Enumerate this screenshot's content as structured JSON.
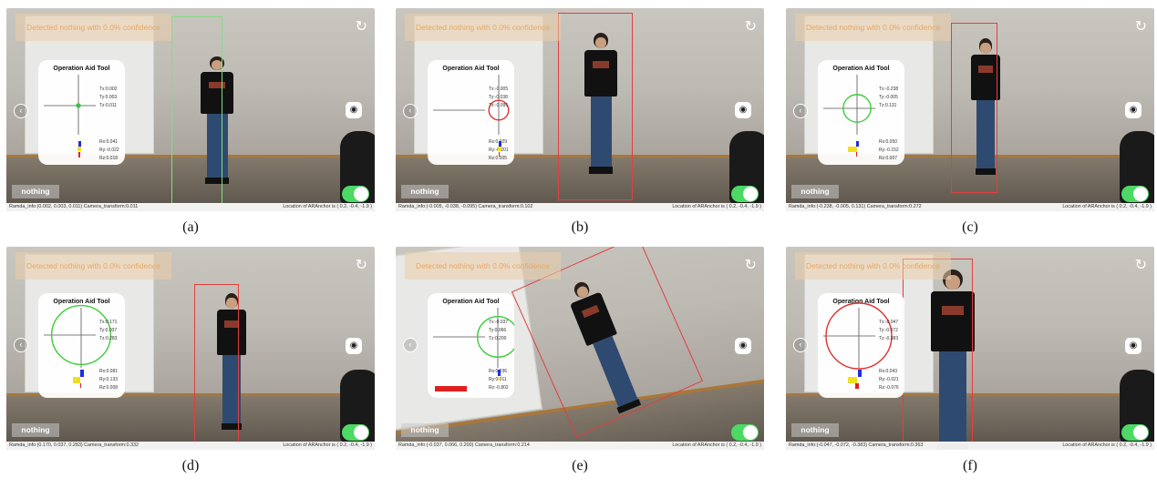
{
  "figure": {
    "panels": [
      {
        "caption": "(a)",
        "detection_text": "Detected nothing with 0.0% confidence",
        "aid_title": "Operation Aid Tool",
        "t_values": [
          "Tx:0.002",
          "Ty:0.003",
          "Tz:0.011"
        ],
        "r_values": [
          "Rx:0.041",
          "Ry:-0.022",
          "Rz:0.018"
        ],
        "nothing_label": "nothing",
        "status_left": "Ramda_info:(0.002, 0.003, 0.011)  Camera_transform:0.011",
        "status_right": "Location of ARAnchor is ( 0.2, -0.4, -1.9 )",
        "bbox_color": "#7fe07f",
        "circle_color": "#3cc43c",
        "circle_radius_fraction": 0.04
      },
      {
        "caption": "(b)",
        "detection_text": "Detected nothing with 0.0% confidence",
        "aid_title": "Operation Aid Tool",
        "t_values": [
          "Tx:-0.005",
          "Ty:-0.038",
          "Tz:-0.095"
        ],
        "r_values": [
          "Rx:0.029",
          "Ry:-0.201",
          "Rz:0.005"
        ],
        "nothing_label": "nothing",
        "status_left": "Ramda_info:(-0.005, -0.038, -0.095)  Camera_transform:0.102",
        "status_right": "Location of ARAnchor is ( 0.2, -0.4, -1.9 )",
        "bbox_color": "#e04040",
        "circle_color": "#e03030",
        "circle_radius_fraction": 0.3
      },
      {
        "caption": "(c)",
        "detection_text": "Detected nothing with 0.0% confidence",
        "aid_title": "Operation Aid Tool",
        "t_values": [
          "Tx:-0.238",
          "Ty:-0.005",
          "Tz:0.131"
        ],
        "r_values": [
          "Rx:0.050",
          "Ry:-0.152",
          "Rz:0.007"
        ],
        "nothing_label": "nothing",
        "status_left": "Ramda_info:(-0.238, -0.005, 0.131)  Camera_transform:0.272",
        "status_right": "Location of ARAnchor is ( 0.2, -0.4, -1.9 )",
        "bbox_color": "#e04040",
        "circle_color": "#3ccc3c",
        "circle_radius_fraction": 0.42
      },
      {
        "caption": "(d)",
        "detection_text": "Detected nothing with 0.0% confidence",
        "aid_title": "Operation Aid Tool",
        "t_values": [
          "Tx:0.171",
          "Ty:0.037",
          "Tz:0.283"
        ],
        "r_values": [
          "Rx:0.081",
          "Ry:0.133",
          "Rz:0.008"
        ],
        "nothing_label": "nothing",
        "status_left": "Ramda_info:(0.170, 0.037, 0.283)  Camera_transform:0.332",
        "status_right": "Location of ARAnchor is ( 0.2, -0.4, -1.9 )",
        "bbox_color": "#e04040",
        "circle_color": "#3ccc3c",
        "circle_radius_fraction": 0.9
      },
      {
        "caption": "(e)",
        "detection_text": "Detected nothing with 0.0% confidence",
        "aid_title": "Operation Aid Tool",
        "t_values": [
          "Tx:-0.037",
          "Ty:0.066",
          "Tz:0.200"
        ],
        "r_values": [
          "Rx:0.036",
          "Ry:0.011",
          "Rz:-0.802"
        ],
        "nothing_label": "nothing",
        "status_left": "Ramda_info:(-0.037, 0.066, 0.200)  Camera_transform:0.214",
        "status_right": "Location of ARAnchor is ( 0.2, -0.4, -1.9 )",
        "bbox_color": "#e04040",
        "circle_color": "#3ccc3c",
        "circle_radius_fraction": 0.62
      },
      {
        "caption": "(f)",
        "detection_text": "Detected nothing with 0.0% confidence",
        "aid_title": "Operation Aid Tool",
        "t_values": [
          "Tx:-0.047",
          "Ty:-0.072",
          "Tz:-0.383"
        ],
        "r_values": [
          "Rx:0.043",
          "Ry:-0.021",
          "Rz:-0.076"
        ],
        "nothing_label": "nothing",
        "status_left": "Ramda_info:(-0.047, -0.072, -0.383)  Camera_transform:0.363",
        "status_right": "Location of ARAnchor is ( 0.2, -0.4, -1.9 )",
        "bbox_color": "#e04040",
        "circle_color": "#e03030",
        "circle_radius_fraction": 1.0
      }
    ]
  }
}
